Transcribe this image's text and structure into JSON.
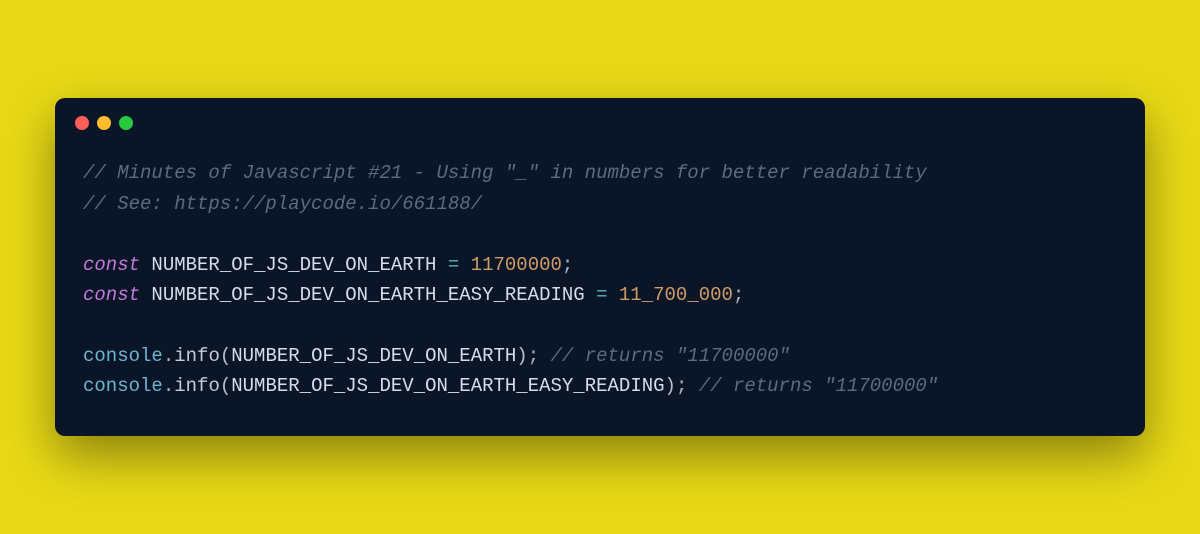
{
  "titlebar": {
    "buttons": [
      "close",
      "minimize",
      "zoom"
    ]
  },
  "code": {
    "line1_comment": "// Minutes of Javascript #21 - Using \"_\" in numbers for better readability",
    "line2_comment": "// See: https://playcode.io/661188/",
    "line3_const": "const",
    "line3_var": " NUMBER_OF_JS_DEV_ON_EARTH ",
    "line3_eq": "=",
    "line3_num": " 11700000",
    "line3_semi": ";",
    "line4_const": "const",
    "line4_var": " NUMBER_OF_JS_DEV_ON_EARTH_EASY_READING ",
    "line4_eq": "=",
    "line4_num": " 11_700_000",
    "line4_semi": ";",
    "line5_obj": "console",
    "line5_dot": ".",
    "line5_method": "info",
    "line5_open": "(",
    "line5_arg": "NUMBER_OF_JS_DEV_ON_EARTH",
    "line5_close": ")",
    "line5_semi": ";",
    "line5_comment": " // returns \"11700000\"",
    "line6_obj": "console",
    "line6_dot": ".",
    "line6_method": "info",
    "line6_open": "(",
    "line6_arg": "NUMBER_OF_JS_DEV_ON_EARTH_EASY_READING",
    "line6_close": ")",
    "line6_semi": ";",
    "line6_comment": " // returns \"11700000\""
  }
}
